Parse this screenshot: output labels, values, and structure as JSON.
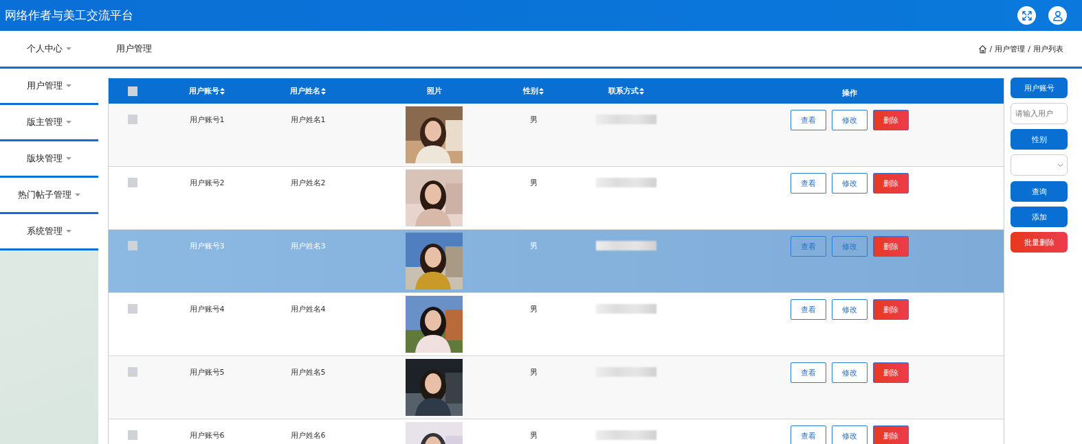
{
  "header": {
    "title": "网络作者与美工交流平台"
  },
  "topnav": {
    "item": "个人中心",
    "page_title": "用户管理",
    "breadcrumb_separator": "/",
    "breadcrumb": [
      "用户管理",
      "用户列表"
    ]
  },
  "sidebar": {
    "items": [
      {
        "label": "用户管理"
      },
      {
        "label": "版主管理"
      },
      {
        "label": "版块管理"
      },
      {
        "label": "热门帖子管理"
      },
      {
        "label": "系统管理"
      }
    ]
  },
  "table": {
    "header_checked": false,
    "columns": [
      {
        "label": "用户账号",
        "sortable": true
      },
      {
        "label": "用户姓名",
        "sortable": true
      },
      {
        "label": "照片",
        "sortable": false
      },
      {
        "label": "性别",
        "sortable": true
      },
      {
        "label": "联系方式",
        "sortable": true
      },
      {
        "label": "操作",
        "sortable": false
      }
    ],
    "rows": [
      {
        "account": "用户账号1",
        "name": "用户姓名1",
        "gender": "男",
        "checked": false,
        "selected": false,
        "actions": [
          {
            "label": "查看",
            "kind": "outline"
          },
          {
            "label": "修改",
            "kind": "outline"
          },
          {
            "label": "删除",
            "kind": "danger"
          }
        ]
      },
      {
        "account": "用户账号2",
        "name": "用户姓名2",
        "gender": "男",
        "checked": false,
        "selected": false,
        "actions": [
          {
            "label": "查看",
            "kind": "outline"
          },
          {
            "label": "修改",
            "kind": "outline"
          },
          {
            "label": "删除",
            "kind": "danger"
          }
        ]
      },
      {
        "account": "用户账号3",
        "name": "用户姓名3",
        "gender": "男",
        "checked": false,
        "selected": true,
        "actions": [
          {
            "label": "查看",
            "kind": "outline"
          },
          {
            "label": "修改",
            "kind": "outline"
          },
          {
            "label": "删除",
            "kind": "danger"
          }
        ]
      },
      {
        "account": "用户账号4",
        "name": "用户姓名4",
        "gender": "男",
        "checked": false,
        "selected": false,
        "actions": [
          {
            "label": "查看",
            "kind": "outline"
          },
          {
            "label": "修改",
            "kind": "outline"
          },
          {
            "label": "删除",
            "kind": "danger"
          }
        ]
      },
      {
        "account": "用户账号5",
        "name": "用户姓名5",
        "gender": "男",
        "checked": false,
        "selected": false,
        "actions": [
          {
            "label": "查看",
            "kind": "outline"
          },
          {
            "label": "修改",
            "kind": "outline"
          },
          {
            "label": "删除",
            "kind": "danger"
          }
        ]
      },
      {
        "account": "用户账号6",
        "name": "用户姓名6",
        "gender": "男",
        "checked": false,
        "selected": false,
        "actions": [
          {
            "label": "查看",
            "kind": "outline"
          },
          {
            "label": "修改",
            "kind": "outline"
          },
          {
            "label": "删除",
            "kind": "danger"
          }
        ]
      }
    ]
  },
  "search_panel": {
    "items": [
      {
        "kind": "label",
        "text": "用户账号"
      },
      {
        "kind": "input",
        "placeholder": "请输入用户"
      },
      {
        "kind": "label",
        "text": "性别"
      },
      {
        "kind": "select"
      },
      {
        "kind": "button",
        "text": "查询"
      },
      {
        "kind": "button",
        "text": "添加"
      },
      {
        "kind": "danger",
        "text": "批量删除"
      }
    ]
  }
}
